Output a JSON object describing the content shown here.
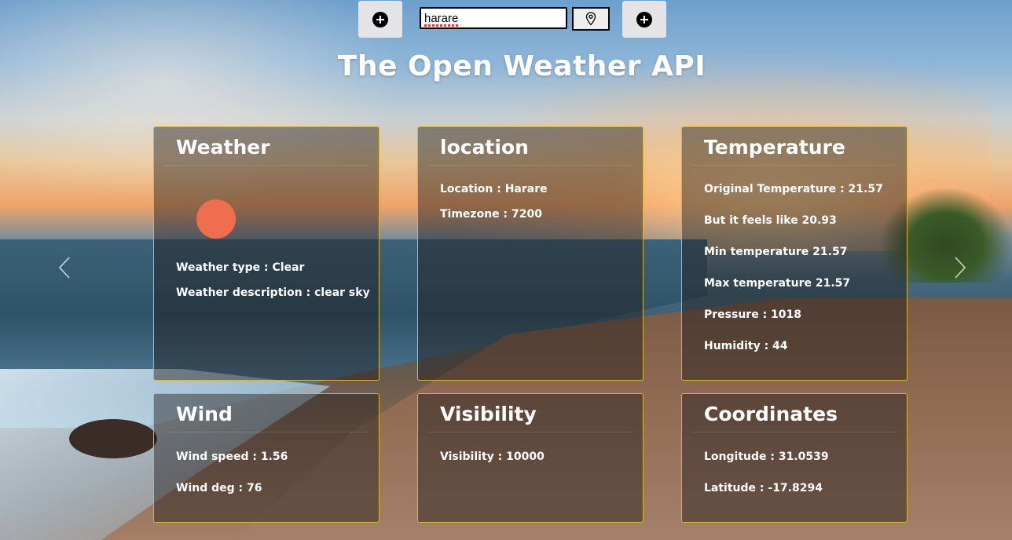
{
  "search": {
    "value": "harare"
  },
  "title": "The Open Weather API",
  "colors": {
    "card_border": "#d8b23a",
    "sun": "#ee6e4e"
  },
  "icons": {
    "add": "plus-circle-icon",
    "location": "map-pin-icon",
    "prev": "chevron-left-icon",
    "next": "chevron-right-icon"
  },
  "cards": {
    "weather": {
      "title": "Weather",
      "icon": "sun-icon",
      "type": "Weather type : Clear",
      "description": "Weather description : clear sky"
    },
    "location": {
      "title": "location",
      "location": "Location : Harare",
      "timezone": "Timezone : 7200"
    },
    "temperature": {
      "title": "Temperature",
      "original": "Original Temperature : 21.57",
      "feels_like": "But it feels like 20.93",
      "min": "Min temperature 21.57",
      "max": "Max temperature 21.57",
      "pressure": "Pressure : 1018",
      "humidity": "Humidity : 44"
    },
    "wind": {
      "title": "Wind",
      "speed": "Wind speed : 1.56",
      "deg": "Wind deg : 76"
    },
    "visibility": {
      "title": "Visibility",
      "visibility": "Visibility : 10000"
    },
    "coordinates": {
      "title": "Coordinates",
      "longitude": "Longitude : 31.0539",
      "latitude": "Latitude : -17.8294"
    }
  }
}
